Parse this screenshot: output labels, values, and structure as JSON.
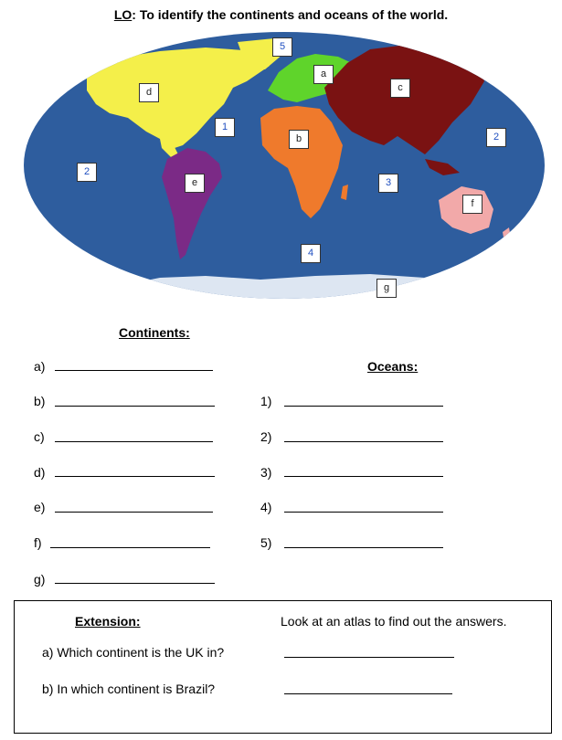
{
  "title": {
    "lo": "LO",
    "rest": ": To identify the continents and oceans of the world."
  },
  "map_labels": {
    "ocean_5": "5",
    "ocean_1": "1",
    "ocean_2_left": "2",
    "ocean_2_right": "2",
    "ocean_3": "3",
    "ocean_4": "4",
    "cont_a": "a",
    "cont_b": "b",
    "cont_c": "c",
    "cont_d": "d",
    "cont_e": "e",
    "cont_f": "f",
    "cont_g": "g"
  },
  "colors": {
    "ocean": "#2e5d9e",
    "north_america": "#f4ef4a",
    "south_america": "#7b2a86",
    "europe": "#5fd42b",
    "africa": "#ef7a2c",
    "asia": "#7a1212",
    "australia": "#f2a9a9",
    "antarctica": "#dde6f2"
  },
  "continents_section": {
    "heading": "Continents:",
    "labels": [
      "a)",
      "b)",
      "c)",
      "d)",
      "e)",
      "f)",
      "g)"
    ]
  },
  "oceans_section": {
    "heading": "Oceans:",
    "labels": [
      "1)",
      "2)",
      "3)",
      "4)",
      "5)"
    ]
  },
  "extension": {
    "heading": "Extension:",
    "instruction": "Look at an atlas to find out the answers.",
    "q1": "a) Which continent is the UK in?",
    "q2": "b) In which continent is Brazil?"
  }
}
